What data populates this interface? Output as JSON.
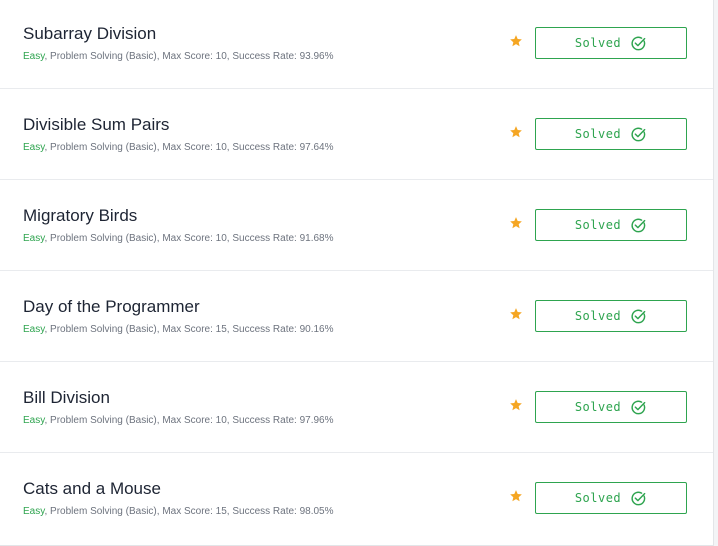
{
  "colors": {
    "accent_green": "#2ea44f",
    "star_orange": "#f5a623",
    "title_text": "#1d2433",
    "meta_text": "#6d737e"
  },
  "challenges": [
    {
      "title": "Subarray Division",
      "difficulty": "Easy",
      "details": ", Problem Solving (Basic), Max Score: 10, Success Rate: 93.96%",
      "status_label": "Solved",
      "star_icon": "star-icon",
      "status_icon": "check-circle-icon"
    },
    {
      "title": "Divisible Sum Pairs",
      "difficulty": "Easy",
      "details": ", Problem Solving (Basic), Max Score: 10, Success Rate: 97.64%",
      "status_label": "Solved",
      "star_icon": "star-icon",
      "status_icon": "check-circle-icon"
    },
    {
      "title": "Migratory Birds",
      "difficulty": "Easy",
      "details": ", Problem Solving (Basic), Max Score: 10, Success Rate: 91.68%",
      "status_label": "Solved",
      "star_icon": "star-icon",
      "status_icon": "check-circle-icon"
    },
    {
      "title": "Day of the Programmer",
      "difficulty": "Easy",
      "details": ", Problem Solving (Basic), Max Score: 15, Success Rate: 90.16%",
      "status_label": "Solved",
      "star_icon": "star-icon",
      "status_icon": "check-circle-icon"
    },
    {
      "title": "Bill Division",
      "difficulty": "Easy",
      "details": ", Problem Solving (Basic), Max Score: 10, Success Rate: 97.96%",
      "status_label": "Solved",
      "star_icon": "star-icon",
      "status_icon": "check-circle-icon"
    },
    {
      "title": "Cats and a Mouse",
      "difficulty": "Easy",
      "details": ", Problem Solving (Basic), Max Score: 15, Success Rate: 98.05%",
      "status_label": "Solved",
      "star_icon": "star-icon",
      "status_icon": "check-circle-icon"
    }
  ]
}
